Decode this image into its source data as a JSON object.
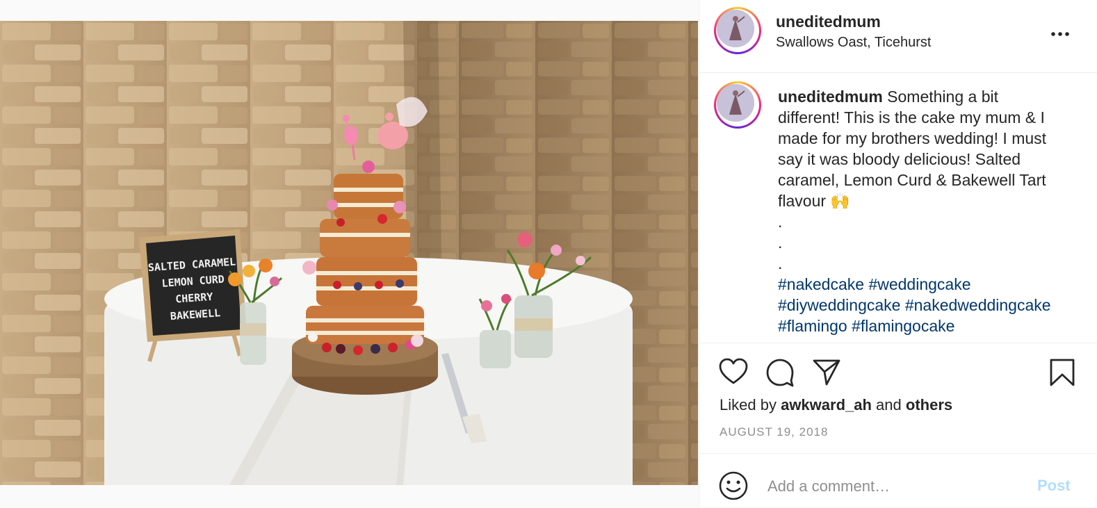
{
  "post": {
    "username": "uneditedmum",
    "location": "Swallows Oast, Ticehurst",
    "caption_lines": [
      "Something a bit",
      "different! This is the cake my mum & I",
      "made for my brothers wedding! I must",
      "say it was bloody delicious! Salted",
      "caramel, Lemon Curd & Bakewell Tart",
      "flavour 🙌"
    ],
    "dots": [
      ".",
      ".",
      "."
    ],
    "hashtags": [
      "#nakedcake",
      "#weddingcake",
      "#diyweddingcake",
      "#nakedweddingcake",
      "#flamingo",
      "#flamingocake"
    ],
    "liked_by_prefix": "Liked by",
    "liked_by_user": "awkward_ah",
    "liked_by_and": "and",
    "liked_by_others": "others",
    "date": "AUGUST 19, 2018"
  },
  "photo_sign": {
    "lines": [
      "SALTED CARAMEL",
      "LEMON CURD",
      "CHERRY",
      "BAKEWELL"
    ]
  },
  "comment": {
    "placeholder": "Add a comment…",
    "post_label": "Post"
  },
  "icons": {
    "more": "more-options-icon",
    "like": "heart-icon",
    "comment": "comment-icon",
    "share": "share-icon",
    "save": "bookmark-icon",
    "emoji": "emoji-icon"
  },
  "colors": {
    "hashtag": "#00376b",
    "post_button_disabled": "#b2dffc",
    "muted": "#8e8e8e"
  }
}
